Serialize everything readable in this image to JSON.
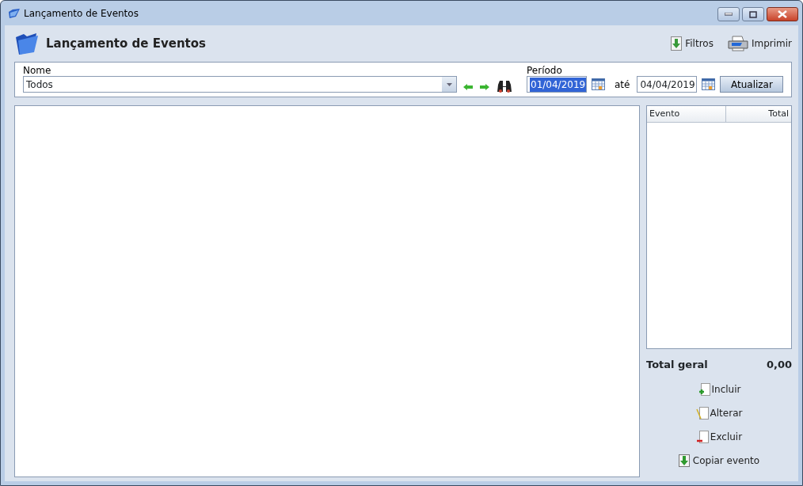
{
  "window": {
    "title": "Lançamento de Eventos"
  },
  "header": {
    "title": "Lançamento de Eventos",
    "actions": [
      {
        "label": "Filtros",
        "kind": "filter"
      },
      {
        "label": "Imprimir",
        "kind": "print"
      }
    ]
  },
  "filters": {
    "name_label": "Nome",
    "name_value": "Todos",
    "period_label": "Período",
    "date_from": {
      "value": "01/04/2019",
      "text_selected": true
    },
    "until_label": "até",
    "date_to": {
      "value": "04/04/2019",
      "text_selected": false
    },
    "refresh_button": "Atualizar"
  },
  "events_table": {
    "columns": [
      "Evento",
      "Total"
    ]
  },
  "total": {
    "label": "Total geral",
    "value": "0,00"
  },
  "actions": [
    {
      "label": "Incluir",
      "kind": "add"
    },
    {
      "label": "Alterar",
      "kind": "edit"
    },
    {
      "label": "Excluir",
      "kind": "delete"
    },
    {
      "label": "Copiar evento",
      "kind": "copy"
    }
  ]
}
